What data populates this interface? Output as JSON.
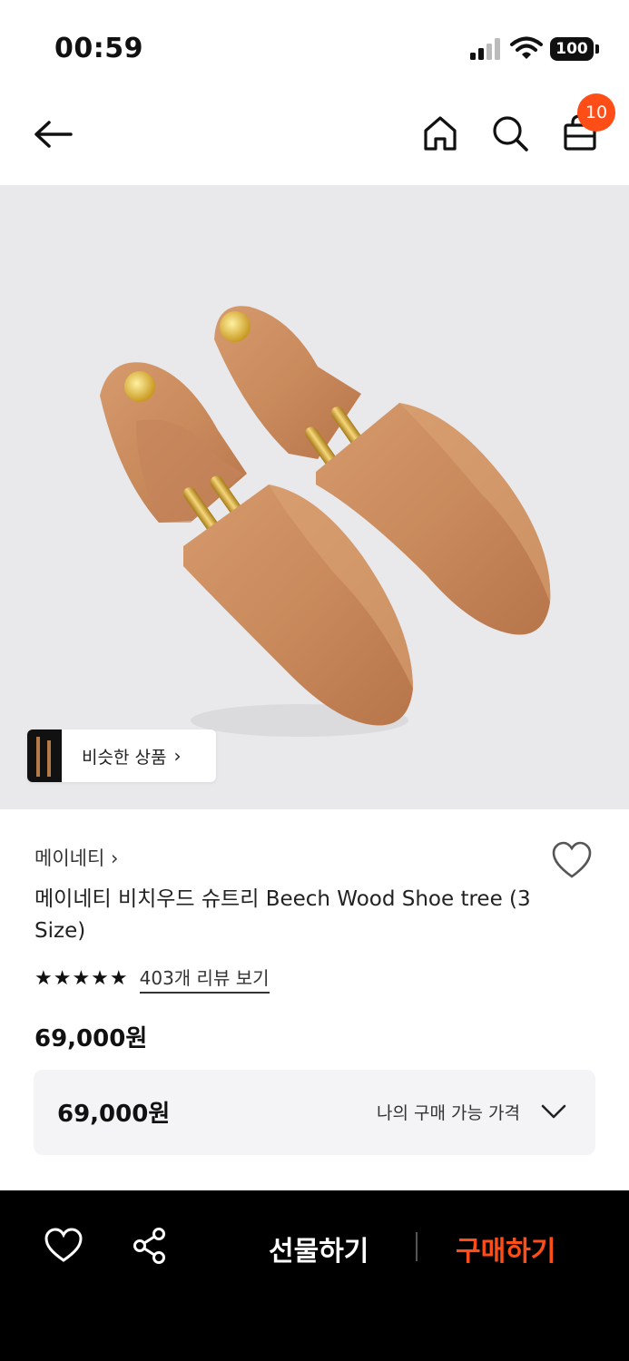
{
  "status_bar": {
    "time": "00:59",
    "battery": "100"
  },
  "nav": {
    "cart_count": "10"
  },
  "hero": {
    "similar_label": "비슷한 상품",
    "similar_chevron": "›"
  },
  "product": {
    "brand": "메이네티 ›",
    "title": "메이네티 비치우드 슈트리 Beech Wood Shoe tree (3 Size)",
    "stars": "★★★★★",
    "review_link": "403개 리뷰 보기",
    "price": "69,000원"
  },
  "price_box": {
    "value": "69,000원",
    "label": "나의 구매 가능 가격"
  },
  "bottom_bar": {
    "gift_label": "선물하기",
    "buy_label": "구매하기"
  },
  "colors": {
    "accent": "#ff4d17",
    "hero_bg": "#e9e9eb",
    "wood": "#c98a5c"
  },
  "icons": [
    "back-arrow-icon",
    "home-icon",
    "search-icon",
    "shopping-bag-icon",
    "heart-icon",
    "share-icon",
    "chevron-down-icon"
  ]
}
